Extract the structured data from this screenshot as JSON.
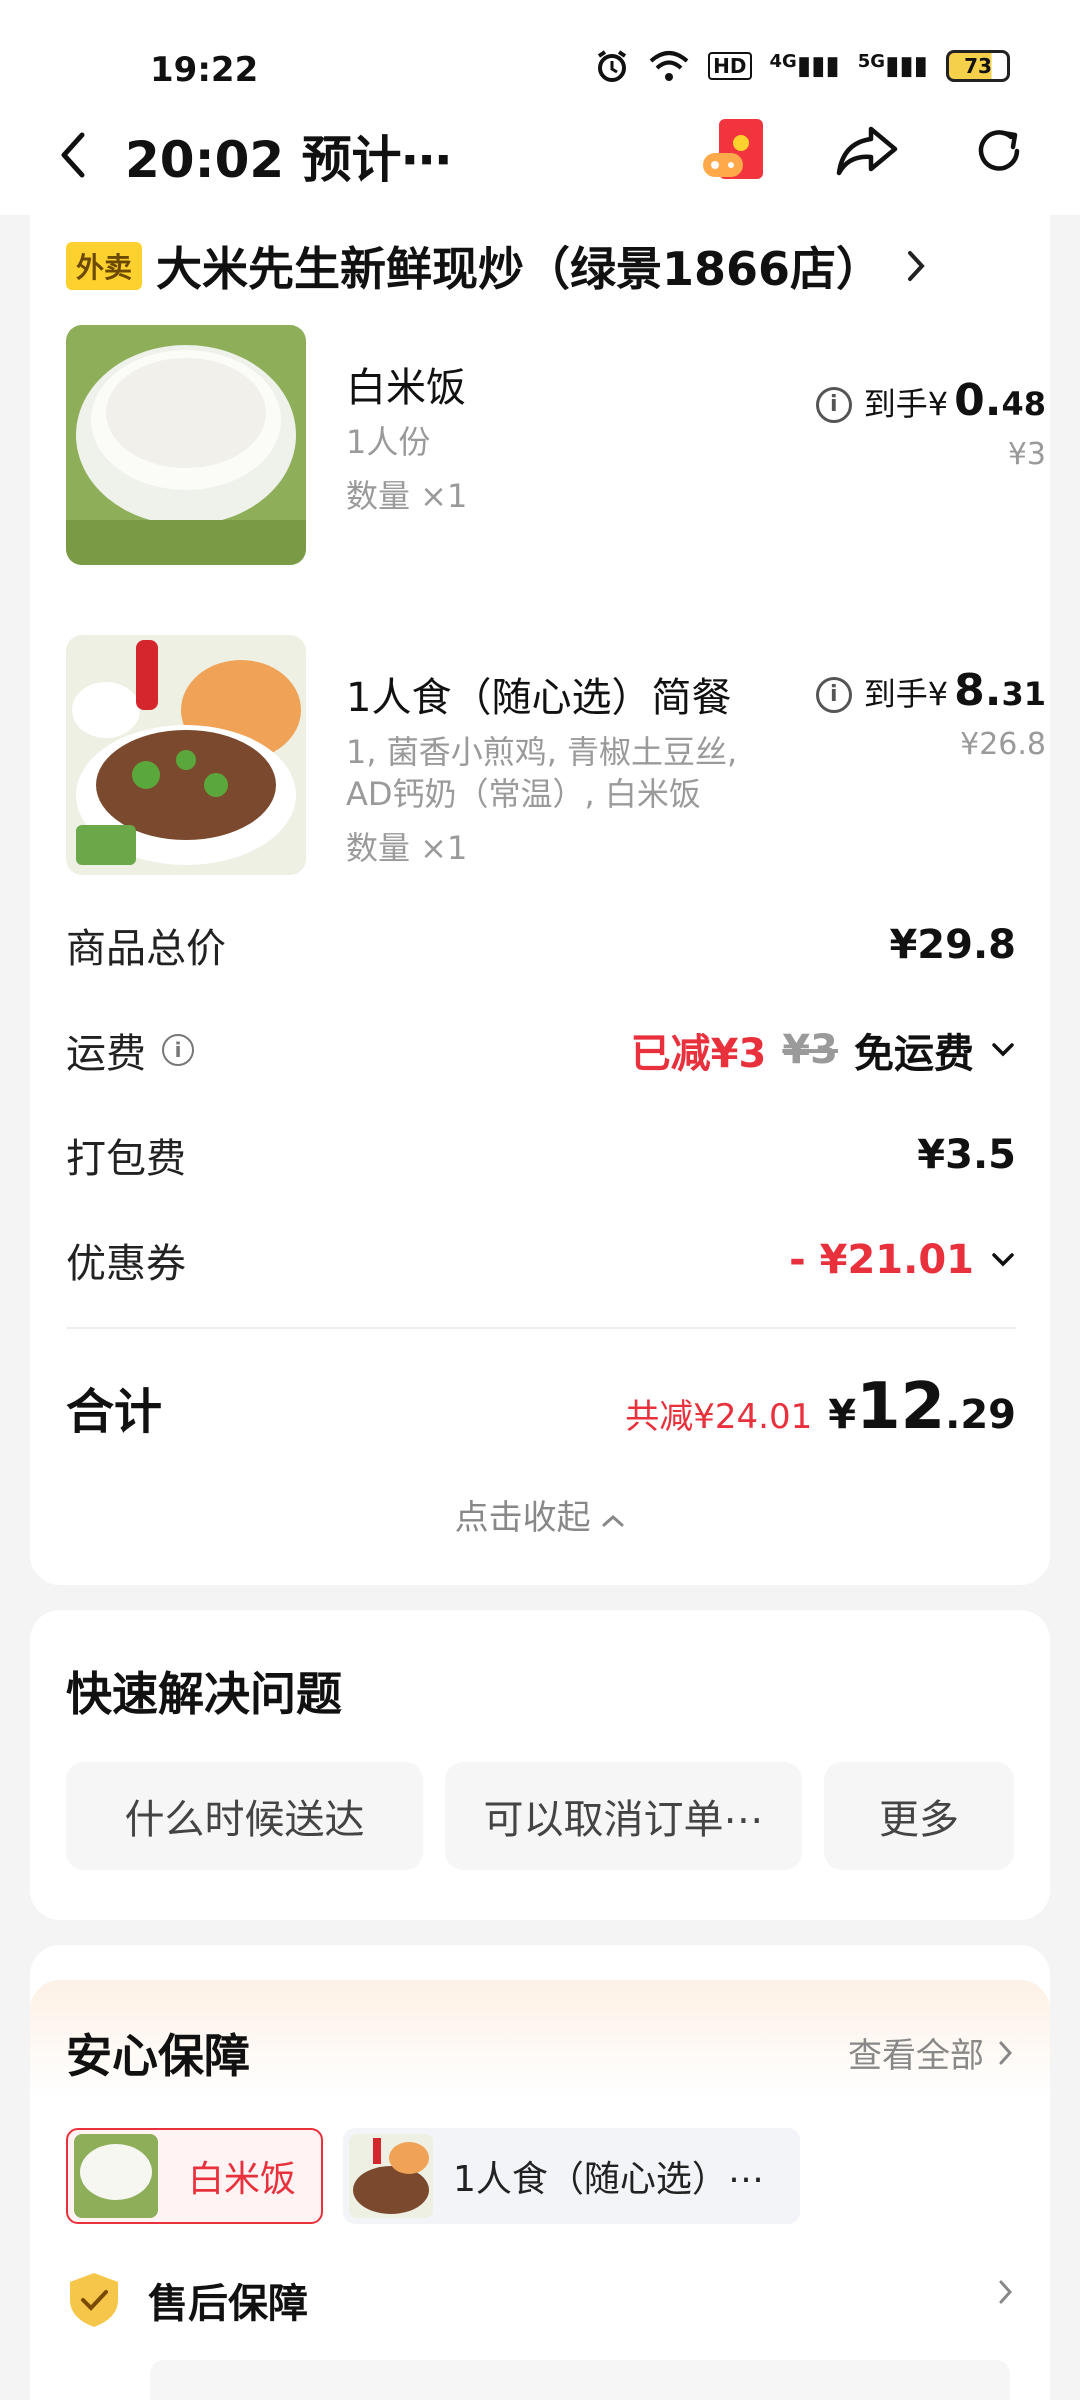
{
  "status_bar": {
    "time": "19:22",
    "hd_label": "HD",
    "net1": "4G",
    "net2": "5G",
    "battery": "73"
  },
  "header": {
    "title": "20:02 预计⋯"
  },
  "store": {
    "tag": "外卖",
    "name": "大米先生新鲜现炒（绿景1866店）"
  },
  "items": [
    {
      "title": "白米饭",
      "sub": "1人份",
      "qty": "数量 ×1",
      "price_prefix": "到手¥",
      "price_int": "0.",
      "price_dec": "48",
      "orig": "¥3"
    },
    {
      "title": "1人食（随心选）简餐",
      "sub": "1, 菌香小煎鸡, 青椒土豆丝, AD钙奶（常温）, 白米饭",
      "qty": "数量 ×1",
      "price_prefix": "到手¥",
      "price_int": "8.",
      "price_dec": "31",
      "orig": "¥26.8"
    }
  ],
  "summary": {
    "goods_label": "商品总价",
    "goods_val": "¥29.8",
    "delivery_label": "运费",
    "delivery_discount": "已减¥3",
    "delivery_orig": "¥3",
    "delivery_val": "免运费",
    "pack_label": "打包费",
    "pack_val": "¥3.5",
    "coupon_label": "优惠券",
    "coupon_val": "- ¥21.01",
    "total_label": "合计",
    "total_saved": "共减¥24.01",
    "total_prefix": "¥",
    "total_int": "12",
    "total_dec": ".29",
    "collapse": "点击收起"
  },
  "quick": {
    "title": "快速解决问题",
    "chips": [
      "什么时候送达",
      "可以取消订单⋯",
      "更多"
    ]
  },
  "safety": {
    "title": "安心保障",
    "link": "查看全部",
    "tabs": [
      "白米饭",
      "1人食（随心选）⋯"
    ],
    "after_sale": "售后保障"
  },
  "colors": {
    "accent_red": "#e8313c",
    "tag_yellow": "#ffd12e"
  }
}
